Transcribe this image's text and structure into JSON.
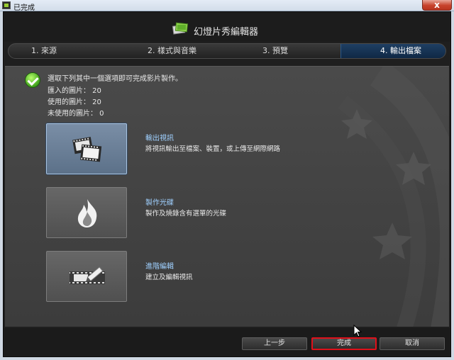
{
  "window": {
    "title": "已完成",
    "close_glyph": "x"
  },
  "app": {
    "title": "幻燈片秀編輯器",
    "steps": [
      "1. 來源",
      "2. 樣式與音樂",
      "3. 預覽",
      "4. 輸出檔案"
    ],
    "active_step": 4
  },
  "info": {
    "instruction": "選取下列其中一個選項即可完成影片製作。",
    "imported": "匯入的圖片： 20",
    "used": "使用的圖片： 20",
    "unused": "未使用的圖片： 0"
  },
  "options": [
    {
      "title": "輸出視訊",
      "desc": "將視訊輸出至檔案、裝置，或上傳至網際網路",
      "icon": "film-strip-icon",
      "selected": true
    },
    {
      "title": "製作光碟",
      "desc": "製作及燒錄含有選單的光碟",
      "icon": "disc-burn-icon",
      "selected": false
    },
    {
      "title": "進階編輯",
      "desc": "建立及編輯視訊",
      "icon": "edit-timeline-icon",
      "selected": false
    }
  ],
  "footer": {
    "back": "上一步",
    "finish": "完成",
    "cancel": "取消"
  },
  "colors": {
    "accent": "#9fd0ff",
    "highlight": "#e0101a",
    "check": "#3fa11c"
  }
}
